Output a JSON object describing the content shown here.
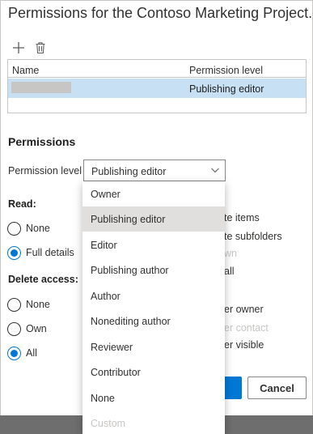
{
  "dialog": {
    "title": "Permissions for the Contoso Marketing Project..."
  },
  "toolbar": {
    "add_icon": "plus-icon",
    "delete_icon": "trash-icon"
  },
  "grid": {
    "columns": [
      "Name",
      "Permission level"
    ],
    "rows": [
      {
        "name": "",
        "permission": "Publishing editor",
        "selected": true
      }
    ]
  },
  "permissions": {
    "title": "Permissions",
    "level_label": "Permission level",
    "level_value": "Publishing editor",
    "read": {
      "label": "Read:",
      "options": [
        {
          "label": "None",
          "checked": false
        },
        {
          "label": "Full details",
          "checked": true
        }
      ]
    },
    "delete_access": {
      "label": "Delete access:",
      "options": [
        {
          "label": "None",
          "checked": false
        },
        {
          "label": "Own",
          "checked": false
        },
        {
          "label": "All",
          "checked": true
        }
      ]
    },
    "partially_hidden": [
      {
        "text": "te items",
        "dim": false
      },
      {
        "text": "te subfolders",
        "dim": false
      },
      {
        "text": "wn",
        "dim": true
      },
      {
        "text": "all",
        "dim": false
      },
      {
        "text": "er owner",
        "dim": false
      },
      {
        "text": "er contact",
        "dim": true
      },
      {
        "text": "er visible",
        "dim": false
      }
    ]
  },
  "buttons": {
    "cancel": "Cancel"
  },
  "dropdown": {
    "options": [
      {
        "label": "Owner",
        "selected": false,
        "disabled": false
      },
      {
        "label": "Publishing editor",
        "selected": true,
        "disabled": false
      },
      {
        "label": "Editor",
        "selected": false,
        "disabled": false
      },
      {
        "label": "Publishing author",
        "selected": false,
        "disabled": false
      },
      {
        "label": "Author",
        "selected": false,
        "disabled": false
      },
      {
        "label": "Nonediting author",
        "selected": false,
        "disabled": false
      },
      {
        "label": "Reviewer",
        "selected": false,
        "disabled": false
      },
      {
        "label": "Contributor",
        "selected": false,
        "disabled": false
      },
      {
        "label": "None",
        "selected": false,
        "disabled": false
      },
      {
        "label": "Custom",
        "selected": false,
        "disabled": true
      }
    ]
  },
  "colors": {
    "accent": "#0078d4",
    "selected_row": "#c7e0f4",
    "hover_item": "#e1dfdd",
    "overlay": "#6e6e6e"
  }
}
